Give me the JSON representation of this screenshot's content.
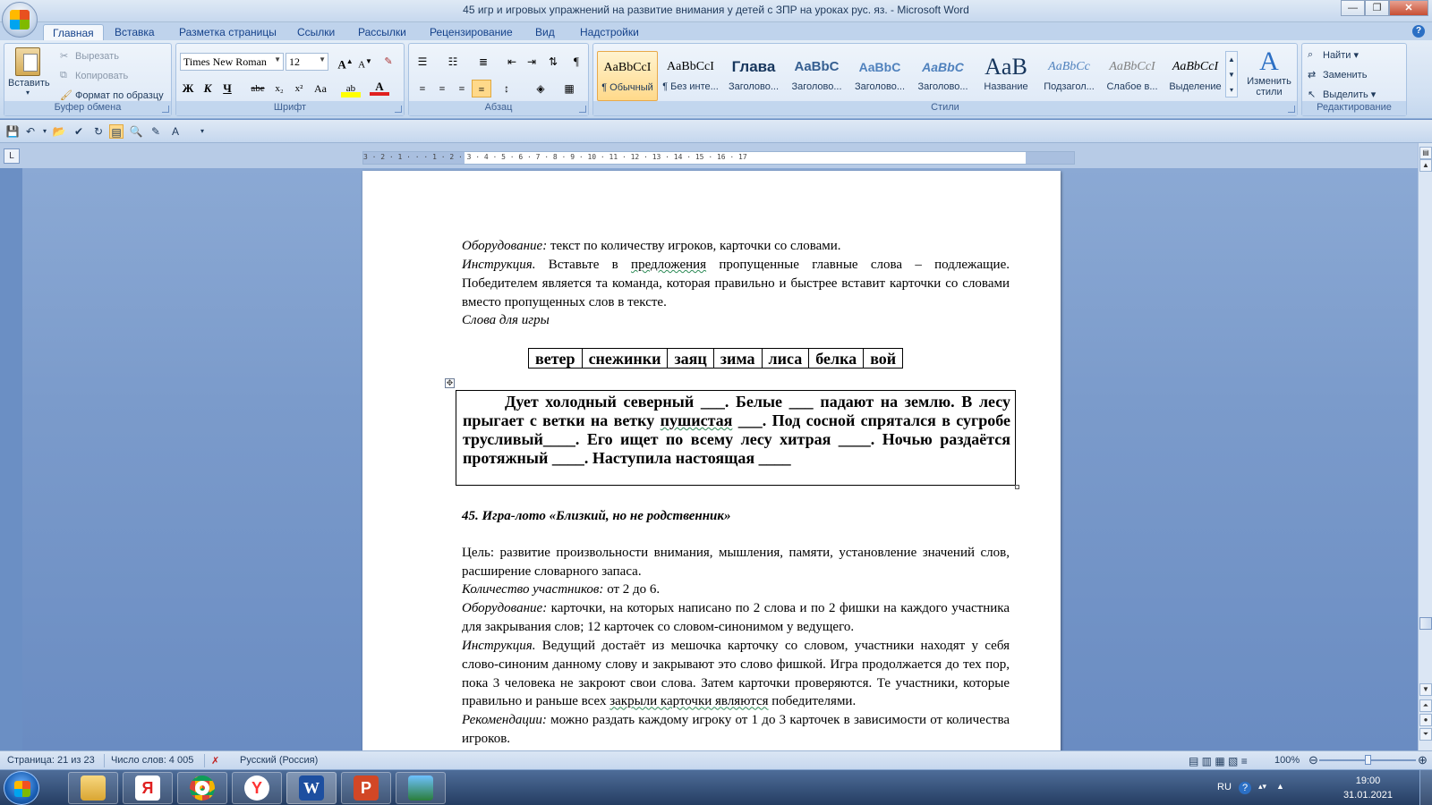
{
  "window": {
    "title": "45 игр и игровых упражнений на развитие внимания у детей с ЗПР на уроках рус. яз. - Microsoft Word",
    "minimize": "0",
    "maximize": "1",
    "close": "✕"
  },
  "tabs": [
    "Главная",
    "Вставка",
    "Разметка страницы",
    "Ссылки",
    "Рассылки",
    "Рецензирование",
    "Вид",
    "Надстройки"
  ],
  "ribbon": {
    "clipboard": {
      "label": "Буфер обмена",
      "paste": "Вставить",
      "cut": "Вырезать",
      "copy": "Копировать",
      "format_painter": "Формат по образцу"
    },
    "font": {
      "label": "Шрифт",
      "font_name": "Times New Roman",
      "font_size": "12",
      "bold": "Ж",
      "italic": "К",
      "underline": "Ч",
      "strike": "abe",
      "subscript": "x₂",
      "superscript": "x²",
      "change_case": "Aa",
      "grow": "A",
      "shrink": "A"
    },
    "paragraph": {
      "label": "Абзац"
    },
    "styles": {
      "label": "Стили",
      "items": [
        {
          "sample": "AaBbCcI",
          "name": "¶ Обычный"
        },
        {
          "sample": "AaBbCcI",
          "name": "¶ Без инте..."
        },
        {
          "sample": "Глава",
          "name": "Заголово..."
        },
        {
          "sample": "AaBbC",
          "name": "Заголово..."
        },
        {
          "sample": "AaBbC",
          "name": "Заголово..."
        },
        {
          "sample": "AaBbC",
          "name": "Заголово..."
        },
        {
          "sample": "AaB",
          "name": "Название"
        },
        {
          "sample": "AaBbCc",
          "name": "Подзагол..."
        },
        {
          "sample": "AaBbCcI",
          "name": "Слабое в..."
        },
        {
          "sample": "AaBbCcI",
          "name": "Выделение"
        }
      ],
      "change_styles": "Изменить стили"
    },
    "editing": {
      "label": "Редактирование",
      "find": "Найти",
      "replace": "Заменить",
      "select": "Выделить"
    }
  },
  "ruler": {
    "corner": "L",
    "ticks": "3 · 2 · 1 · · · 1 · 2 · 3 · 4 · 5 · 6 · 7 · 8 · 9 · 10 · 11 · 12 · 13 · 14 · 15 · 16 · 17"
  },
  "document": {
    "p1_label": "Оборудование:",
    "p1_text": " текст по количеству игроков, карточки со словами.",
    "p2_label": "Инструкция.",
    "p2_text_a": " Вставьте в ",
    "p2_wavy": "предложения",
    "p2_text_b": " пропущенные главные слова – подлежащие.  Победителем является та команда, которая правильно и быстрее вставит карточки со словами вместо пропущенных слов в тексте.",
    "p3": "Слова для игры",
    "words": [
      "ветер",
      "снежинки",
      "заяц",
      "зима",
      "лиса",
      "белка",
      "вой"
    ],
    "box_text_a": "Дует холодный северный ___. Белые ___ падают на землю. В лесу прыгает с ветки на ветку ",
    "box_wavy": "пушистая",
    "box_text_b": " ___. Под сосной спрятался в сугробе трусливый____. Его ищет по всему лесу хитрая ____. Ночью раздаётся протяжный ____. Наступила настоящая ____",
    "heading": "45. Игра-лото  «Близкий, но не родственник»",
    "goal": "Цель: развитие произвольности внимания, мышления, памяти, установление значений слов, расширение словарного запаса.",
    "count_label": "Количество участников:",
    "count_text": " от 2 до 6.",
    "equip_label": "Оборудование:",
    "equip_text": " карточки, на которых написано по 2 слова и по 2 фишки на каждого участника для закрывания слов; 12 карточек со словом-синонимом у ведущего.",
    "instr_label": "Инструкция.",
    "instr_text_a": " Ведущий достаёт из мешочка карточку со словом,  участники находят у себя слово-синоним данному слову и закрывают это слово фишкой. Игра продолжается  до тех пор, пока 3 человека не закроют свои слова. Затем карточки проверяются. Те участники, которые правильно и раньше всех ",
    "instr_wavy": "закрыли карточки являются",
    "instr_text_b": " победителями.",
    "rec_label": "Рекомендации:",
    "rec_text": " можно раздать каждому игроку от 1 до 3 карточек в зависимости от количества игроков."
  },
  "status": {
    "page": "Страница: 21 из 23",
    "words": "Число слов: 4 005",
    "language": "Русский (Россия)",
    "zoom": "100%"
  },
  "taskbar": {
    "lang": "RU",
    "time": "19:00",
    "date": "31.01.2021"
  }
}
